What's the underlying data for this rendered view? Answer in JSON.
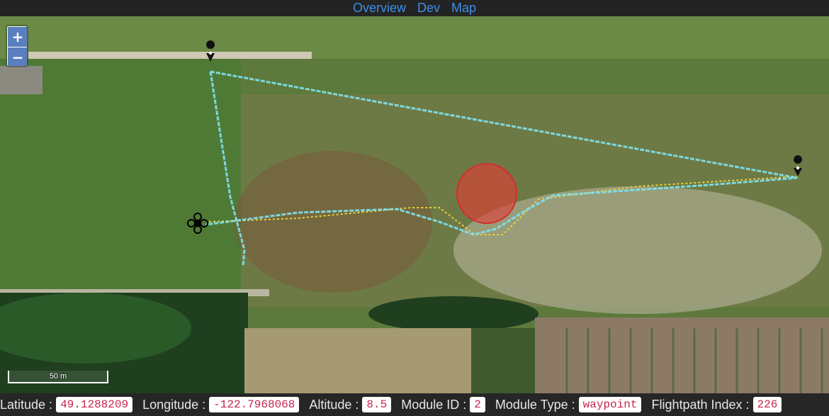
{
  "nav": {
    "items": [
      "Overview",
      "Dev",
      "Map"
    ]
  },
  "map": {
    "zoom_in": "+",
    "zoom_out": "−",
    "scale_label": "50 m"
  },
  "status": {
    "latitude_label": "Latitude :",
    "latitude": "49.1288209",
    "longitude_label": "Longitude :",
    "longitude": "-122.7968068",
    "altitude_label": "Altitude :",
    "altitude": "8.5",
    "module_id_label": "Module ID :",
    "module_id": "2",
    "module_type_label": "Module Type :",
    "module_type": "waypoint",
    "flightpath_label": "Flightpath Index :",
    "flightpath_index": "226"
  },
  "colors": {
    "track": "#7fe3f0",
    "planned": "#e8d23a",
    "obstacle": "#e53935",
    "link": "#3d8fe8"
  }
}
